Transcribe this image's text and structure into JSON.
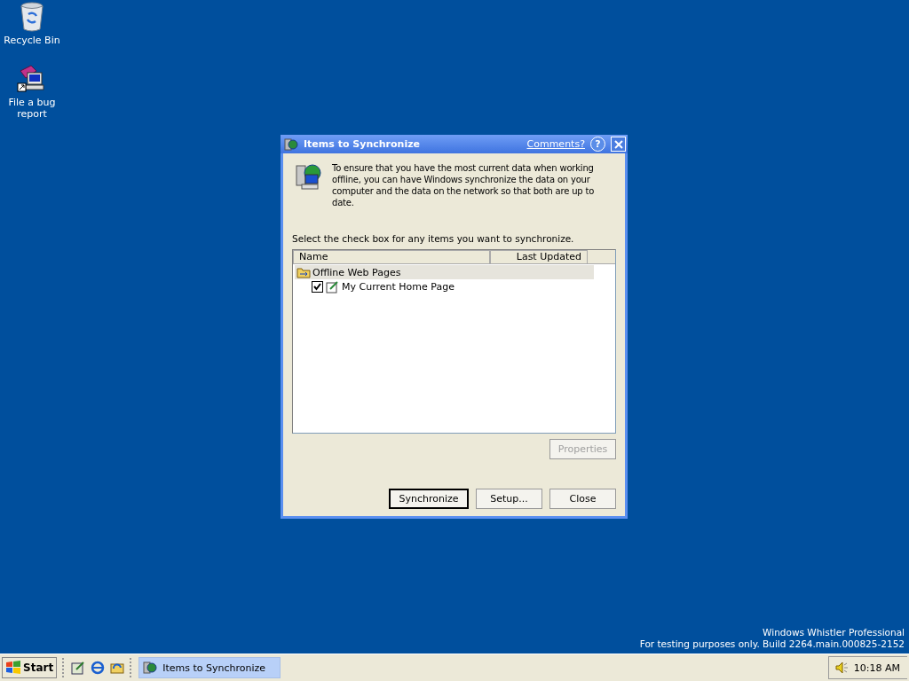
{
  "desktop_icons": [
    {
      "label": "Recycle Bin",
      "kind": "recycle"
    },
    {
      "label": "File a bug report",
      "kind": "bug"
    }
  ],
  "dialog": {
    "title": "Items to Synchronize",
    "comments_link": "Comments?",
    "help_button": "?",
    "intro": "To ensure that you have the most current data when working offline, you can have Windows synchronize the data on your computer and the data on the network so that both are up to date.",
    "instruction": "Select the check box for any items you want to synchronize.",
    "list": {
      "columns": [
        "Name",
        "Last Updated"
      ],
      "groups": [
        {
          "name": "Offline Web Pages",
          "selected": true,
          "children": [
            {
              "name": "My Current Home Page",
              "checked": true
            }
          ]
        }
      ]
    },
    "properties_button": {
      "label": "Properties",
      "disabled": true
    },
    "buttons": [
      {
        "label": "Synchronize",
        "default": true
      },
      {
        "label": "Setup...",
        "default": false
      },
      {
        "label": "Close",
        "default": false
      }
    ]
  },
  "build_info": [
    "Windows Whistler Professional",
    "For testing purposes only. Build 2264.main.000825-2152"
  ],
  "taskbar": {
    "start": "Start",
    "tasks": [
      {
        "label": "Items to Synchronize",
        "selected": true
      }
    ],
    "clock": "10:18 AM"
  }
}
